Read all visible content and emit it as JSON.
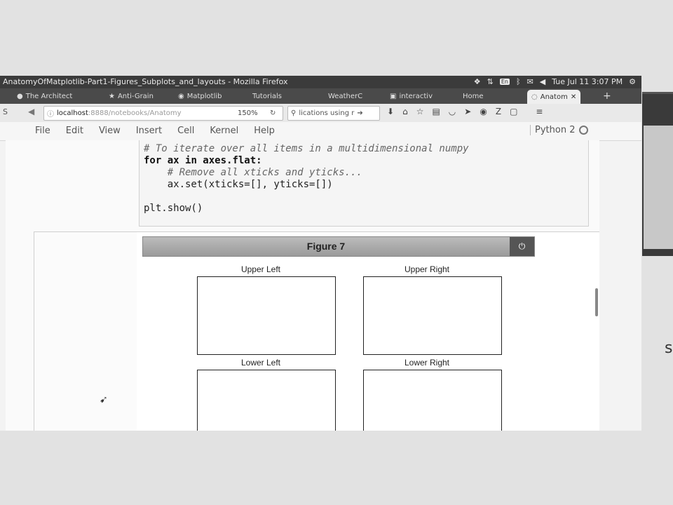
{
  "window": {
    "title": "AnatomyOfMatplotlib-Part1-Figures_Subplots_and_layouts - Mozilla Firefox",
    "clock": "Tue Jul 11  3:07 PM",
    "tray_badge": "En"
  },
  "tabs": [
    {
      "label": "The Architect"
    },
    {
      "label": "Anti-Grain"
    },
    {
      "label": "Matplotlib"
    },
    {
      "label": "Tutorials"
    },
    {
      "label": "WeatherC"
    },
    {
      "label": "interactiv"
    },
    {
      "label": "Home"
    },
    {
      "label": "Anatom"
    }
  ],
  "nav": {
    "host": "localhost",
    "path": ":8888/notebooks/Anatomy",
    "zoom": "150%",
    "search": "lications using r"
  },
  "notebook_menu": {
    "items": [
      "File",
      "Edit",
      "View",
      "Insert",
      "Cell",
      "Kernel",
      "Help"
    ],
    "kernel": "Python 2"
  },
  "code": {
    "line1": "# To iterate over all items in a multidimensional numpy",
    "line2_kw1": "for",
    "line2_mid": " ax ",
    "line2_kw2": "in",
    "line2_end": " axes.flat:",
    "line3": "    # Remove all xticks and yticks...",
    "line4": "    ax.set(xticks=[], yticks=[])",
    "line6": "plt.show()"
  },
  "figure": {
    "title": "Figure 7",
    "subplots": [
      {
        "title": "Upper Left"
      },
      {
        "title": "Upper Right"
      },
      {
        "title": "Lower Left"
      },
      {
        "title": "Lower Right"
      }
    ]
  }
}
